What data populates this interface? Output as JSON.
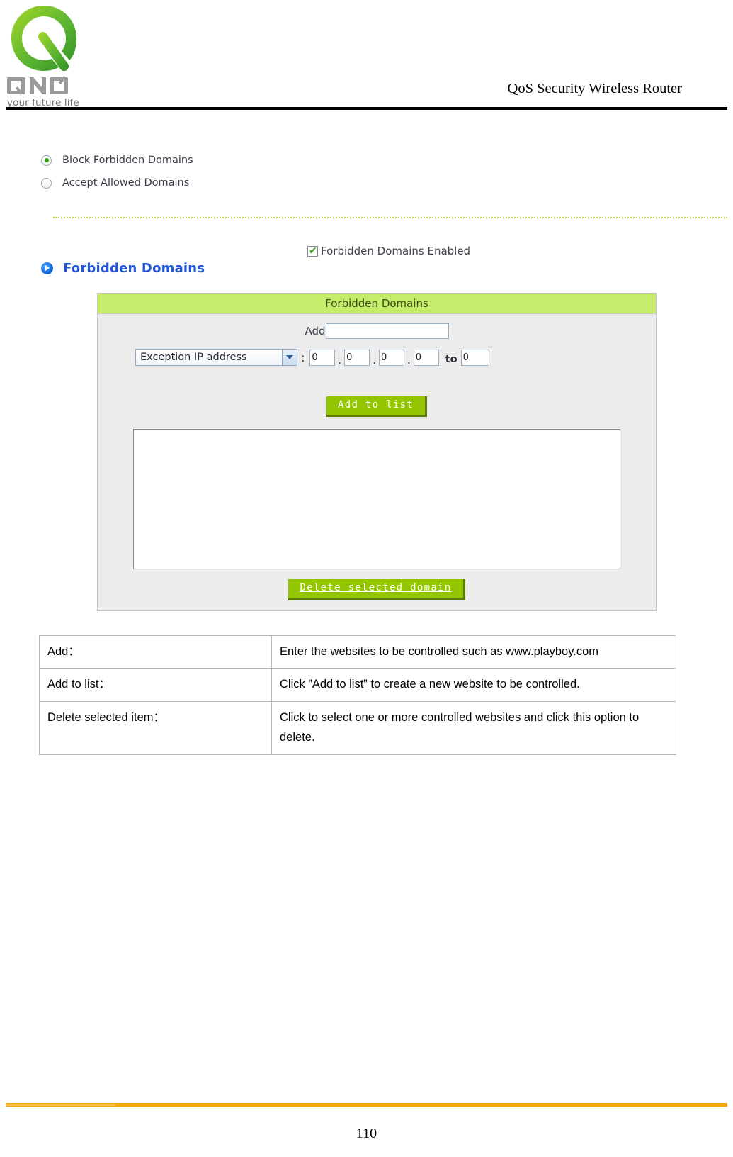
{
  "header": {
    "title": "QoS Security Wireless Router",
    "logo_tagline": "your future life",
    "logo_word": "QNO"
  },
  "options": {
    "items": [
      {
        "label": "Block Forbidden Domains",
        "selected": true
      },
      {
        "label": "Accept Allowed Domains",
        "selected": false
      }
    ]
  },
  "enable": {
    "label": "Forbidden Domains Enabled",
    "checked": true,
    "tick": "✔"
  },
  "section": {
    "title": "Forbidden Domains"
  },
  "panel": {
    "title": "Forbidden Domains",
    "add_label": "Add",
    "add_value": "",
    "add_placeholder": "",
    "select_value": "Exception IP address",
    "colon": ":",
    "ip": {
      "octets": [
        "0",
        "0",
        "0",
        "0"
      ],
      "separator": ".",
      "to_label": "to",
      "to_value": "0"
    },
    "add_to_list_button": "Add to list",
    "delete_button": "Delete selected domain",
    "list_items": []
  },
  "description": {
    "rows": [
      {
        "key": "Add：",
        "value": "Enter the websites to be controlled such as www.playboy.com"
      },
      {
        "key": "Add to list：",
        "value": "Click ”Add to list” to create a new website to be controlled."
      },
      {
        "key": "Delete selected item：",
        "value": "Click to select one or more controlled websites and click this option to delete."
      }
    ]
  },
  "footer": {
    "page_number": "110"
  },
  "colors": {
    "panel_title_bg": "#c5ec6a",
    "button_green": "#93c600",
    "button_shadow": "#5c7d00",
    "heading_blue": "#2156d8",
    "footer_orange": "#f7a70c",
    "divider_green": "#b9d34a",
    "radio_dot_green": "#2fa309"
  }
}
